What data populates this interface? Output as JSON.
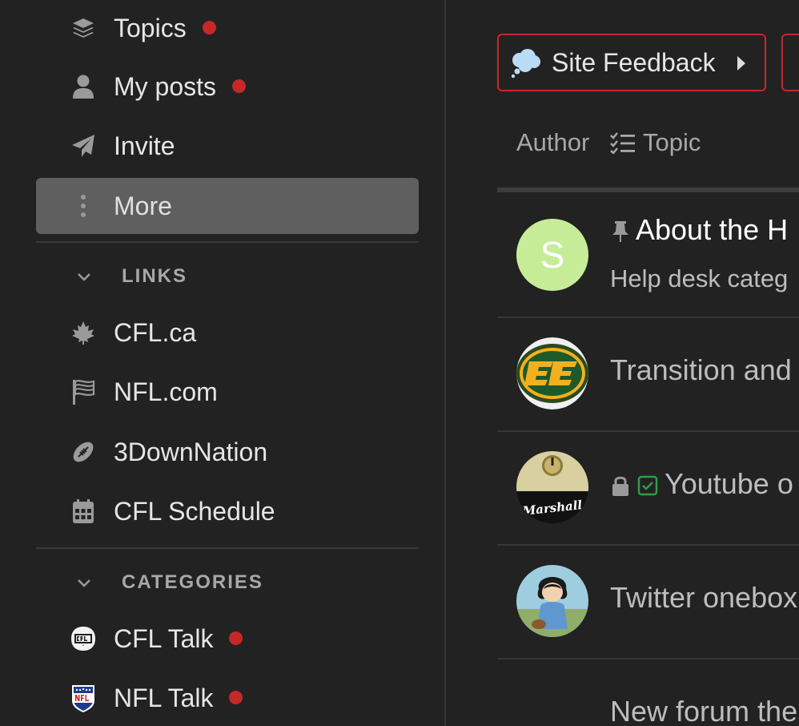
{
  "sidebar": {
    "nav": [
      {
        "label": "Topics",
        "icon": "layers-icon",
        "unread": true
      },
      {
        "label": "My posts",
        "icon": "user-icon",
        "unread": true
      },
      {
        "label": "Invite",
        "icon": "paper-plane-icon",
        "unread": false
      },
      {
        "label": "More",
        "icon": "vertical-ellipsis-icon",
        "unread": false,
        "active": true
      }
    ],
    "links": {
      "title": "LINKS",
      "items": [
        {
          "label": "CFL.ca",
          "icon": "maple-leaf-icon"
        },
        {
          "label": "NFL.com",
          "icon": "flag-icon"
        },
        {
          "label": "3DownNation",
          "icon": "football-icon"
        },
        {
          "label": "CFL Schedule",
          "icon": "calendar-icon"
        }
      ]
    },
    "categories": {
      "title": "CATEGORIES",
      "items": [
        {
          "label": "CFL Talk",
          "icon": "cfl-logo-icon",
          "unread": true
        },
        {
          "label": "NFL Talk",
          "icon": "nfl-logo-icon",
          "unread": true
        }
      ]
    }
  },
  "main": {
    "category_button": {
      "label": "Site Feedback",
      "icon": "thought-cloud-icon"
    },
    "headers": {
      "author": "Author",
      "topic": "Topic"
    },
    "topics": [
      {
        "title": "About the H",
        "excerpt": "Help desk categ",
        "pinned": true,
        "avatar_letter": "S",
        "avatar_color": "#c6ec98"
      },
      {
        "title": "Transition and"
      },
      {
        "title": "Youtube o",
        "locked": true,
        "solved": true
      },
      {
        "title": "Twitter onebox"
      },
      {
        "title": "New forum the"
      }
    ]
  },
  "colors": {
    "background": "#222222",
    "unread_dot": "#c62828",
    "active_item": "#5f5f5f",
    "solved": "#2e9d46"
  }
}
